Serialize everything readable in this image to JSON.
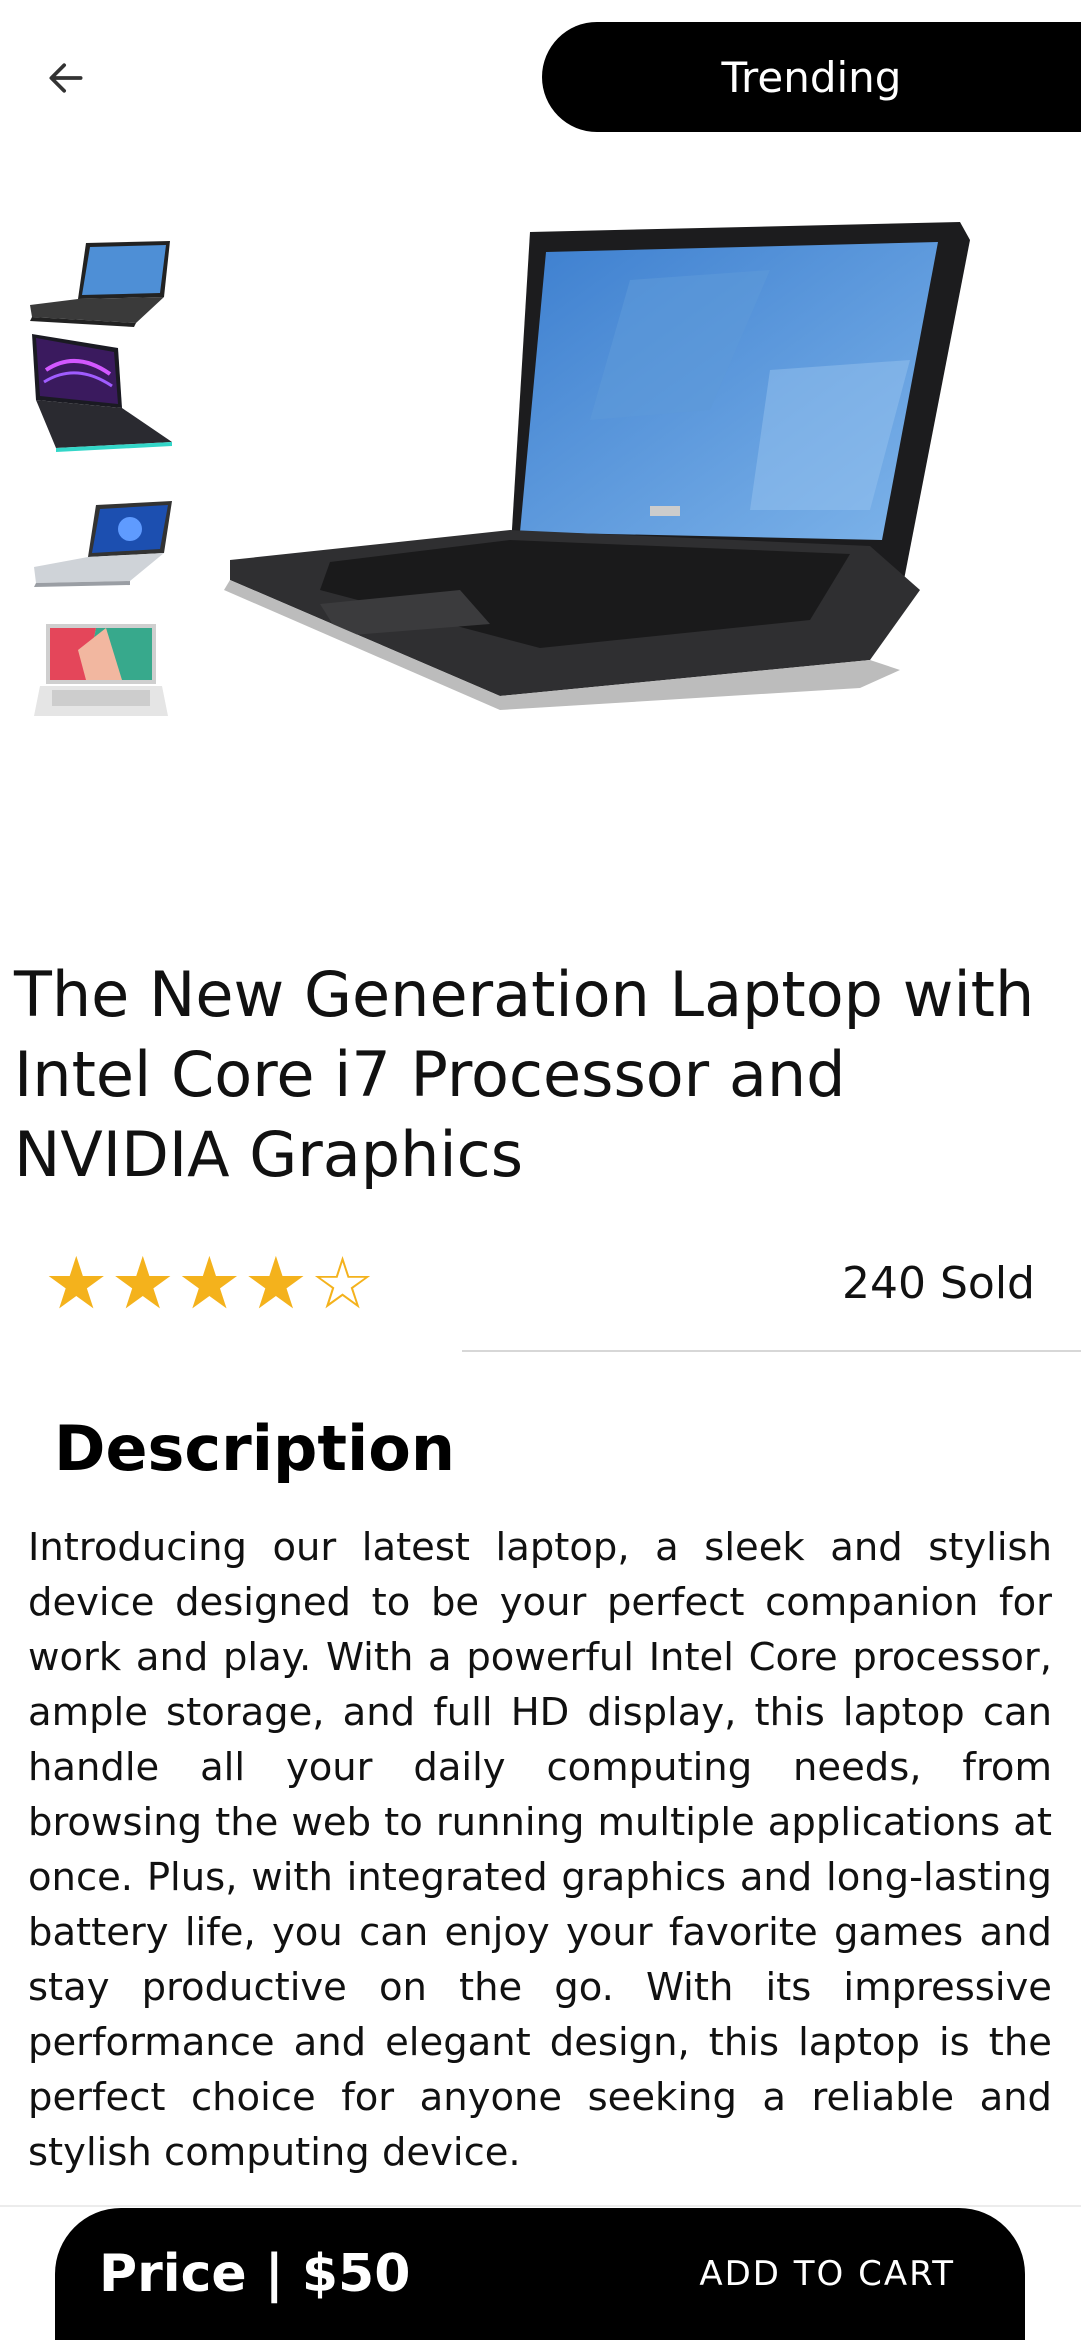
{
  "header": {
    "back_icon": "arrow-left-icon",
    "badge": "Trending"
  },
  "gallery": {
    "thumbnails": [
      "laptop-thumbnail-1",
      "laptop-thumbnail-2",
      "laptop-thumbnail-3",
      "laptop-thumbnail-4"
    ],
    "main_image": "laptop-main-image"
  },
  "product": {
    "title": "The New Generation Laptop with Intel Core i7 Processor and NVIDIA Graphics",
    "rating": 4,
    "rating_max": 5,
    "sold": "240 Sold"
  },
  "description": {
    "heading": "Description",
    "body": "Introducing our latest laptop, a sleek and stylish device designed to be your perfect companion for work and play. With a powerful Intel Core processor, ample storage, and full HD display, this laptop can handle all your daily computing needs, from browsing the web to running multiple applications at once. Plus, with integrated graphics and long-lasting battery life, you can enjoy your favorite games and stay productive on the go. With its impressive performance and elegant design, this laptop is the perfect choice for anyone seeking a reliable and stylish computing device."
  },
  "cart": {
    "price_label": "Price | $50",
    "add_to_cart": "ADD TO CART"
  },
  "colors": {
    "star": "#f4b21c",
    "bar": "#000000"
  }
}
